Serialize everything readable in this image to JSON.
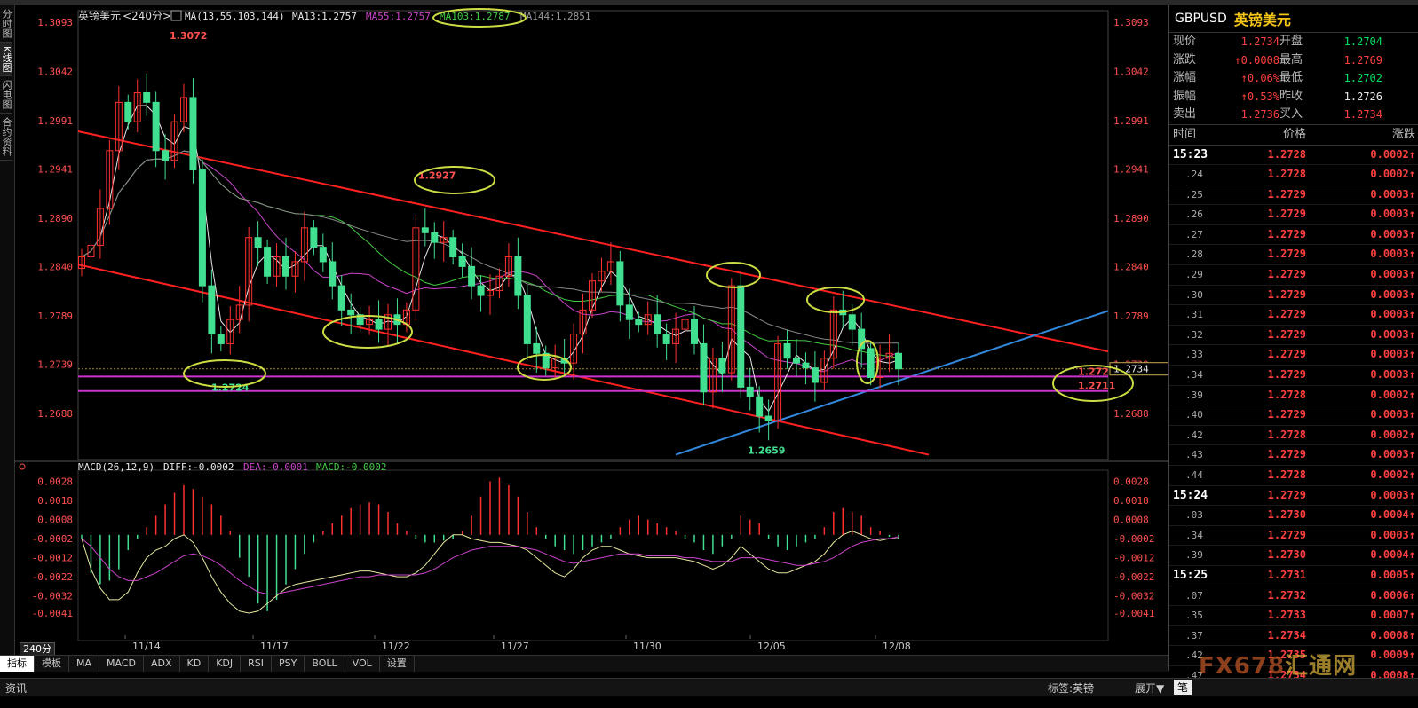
{
  "left_tabs": [
    "分时图",
    "K线图",
    "闪电图",
    "合约资料"
  ],
  "header": {
    "symbol": "英镑美元",
    "period": "<240分>",
    "ma_params": "MA(13,55,103,144)",
    "ma13": "MA13:1.2757",
    "ma55": "MA55:1.2757",
    "ma103": "MA103:1.2787",
    "ma144": "MA144:1.2851"
  },
  "macd_header": {
    "params": "MACD(26,12,9)",
    "diff": "DIFF:-0.0002",
    "dea": "DEA:-0.0001",
    "macd": "MACD:-0.0002"
  },
  "colors": {
    "up": "#ff3030",
    "down": "#40e090",
    "ma13": "#e8e8e8",
    "ma55": "#cc44cc",
    "ma103": "#44cc44",
    "ma144": "#888888",
    "channel": "#ff2020",
    "support": "#cc33cc",
    "trend_blue": "#3388dd",
    "highlight": "#ccdd44"
  },
  "chart_data": {
    "type": "candlestick",
    "symbol": "GBPUSD",
    "y_ticks": [
      "1.3093",
      "1.3042",
      "1.2991",
      "1.2941",
      "1.2890",
      "1.2840",
      "1.2789",
      "1.2739",
      "1.2688"
    ],
    "ylim": [
      1.264,
      1.3105
    ],
    "x_tick_labels": [
      "11/14",
      "11/17",
      "11/22",
      "11/27",
      "11/30",
      "12/05",
      "12/08"
    ],
    "annotations": [
      "1.3072",
      "1.2927",
      "1.2724",
      "1.2659",
      "1.2726",
      "1.2711"
    ],
    "current_price_tag": "1.2734",
    "support_levels": [
      1.2726,
      1.2711
    ],
    "closes": [
      1.285,
      1.2862,
      1.29,
      1.296,
      1.301,
      1.299,
      1.302,
      1.301,
      1.296,
      1.295,
      1.299,
      1.3015,
      1.294,
      1.282,
      1.277,
      1.276,
      1.2785,
      1.28,
      1.287,
      1.286,
      1.283,
      1.285,
      1.283,
      1.2845,
      1.288,
      1.286,
      1.2845,
      1.282,
      1.2795,
      1.279,
      1.278,
      1.2785,
      1.2775,
      1.279,
      1.278,
      1.2795,
      1.288,
      1.2875,
      1.2865,
      1.287,
      1.285,
      1.284,
      1.282,
      1.281,
      1.2815,
      1.283,
      1.285,
      1.281,
      1.276,
      1.275,
      1.2735,
      1.2745,
      1.274,
      1.277,
      1.2795,
      1.2825,
      1.2835,
      1.2845,
      1.28,
      1.2785,
      1.278,
      1.279,
      1.277,
      1.276,
      1.2775,
      1.2785,
      1.276,
      1.271,
      1.2745,
      1.273,
      1.282,
      1.2715,
      1.2705,
      1.2685,
      1.268,
      1.276,
      1.2745,
      1.274,
      1.2735,
      1.272,
      1.2745,
      1.2795,
      1.279,
      1.2775,
      1.2755,
      1.2725,
      1.2745,
      1.275,
      1.2734
    ],
    "macd_y_ticks": [
      "0.0028",
      "0.0018",
      "0.0008",
      "-0.0002",
      "-0.0012",
      "-0.0022",
      "-0.0032",
      "-0.0041"
    ],
    "macd_ylim": [
      -0.0048,
      0.0032
    ],
    "macd_hist": [
      -0.0002,
      -0.002,
      -0.0026,
      -0.0024,
      -0.0018,
      -0.0008,
      -0.0002,
      0.0004,
      0.001,
      0.0016,
      0.0022,
      0.0026,
      0.0024,
      0.002,
      0.0016,
      0.001,
      0.0002,
      -0.0012,
      -0.0022,
      -0.0036,
      -0.004,
      -0.0034,
      -0.0026,
      -0.0018,
      -0.001,
      -0.0004,
      0.0002,
      0.0006,
      0.001,
      0.0014,
      0.0016,
      0.0017,
      0.0016,
      0.0012,
      0.0006,
      0.0002,
      -0.0002,
      -0.0004,
      -0.0004,
      -0.0003,
      -0.0002,
      0.0002,
      0.001,
      0.002,
      0.0028,
      0.003,
      0.0026,
      0.002,
      0.0012,
      0.0004,
      -0.0002,
      -0.0006,
      -0.0008,
      -0.001,
      -0.0008,
      -0.0006,
      -0.0004,
      -0.0002,
      0.0004,
      0.0008,
      0.001,
      0.0008,
      0.0006,
      0.0004,
      0.0002,
      -0.0002,
      -0.0004,
      -0.0008,
      -0.001,
      -0.0006,
      -0.0002,
      0.001,
      0.0008,
      0.0006,
      -0.0002,
      -0.0006,
      -0.0008,
      -0.0006,
      -0.0004,
      -0.0002,
      0.0004,
      0.0012,
      0.0014,
      0.0012,
      0.001,
      0.0004,
      0.0002,
      -0.0001,
      -0.0002
    ],
    "macd_diff": [
      -0.0002,
      -0.0018,
      -0.0028,
      -0.0034,
      -0.0034,
      -0.003,
      -0.002,
      -0.0012,
      -0.0008,
      -0.0006,
      -0.0002,
      0.0,
      -0.0004,
      -0.0012,
      -0.0022,
      -0.003,
      -0.0036,
      -0.004,
      -0.0041,
      -0.004,
      -0.0036,
      -0.0032,
      -0.0028,
      -0.0026,
      -0.0025,
      -0.0024,
      -0.0023,
      -0.0022,
      -0.0021,
      -0.002,
      -0.0019,
      -0.0019,
      -0.002,
      -0.0021,
      -0.0022,
      -0.0022,
      -0.002,
      -0.0016,
      -0.001,
      -0.0004,
      0.0,
      0.0,
      -0.0002,
      -0.0003,
      -0.0004,
      -0.0004,
      -0.0005,
      -0.0006,
      -0.0008,
      -0.0012,
      -0.0016,
      -0.002,
      -0.0022,
      -0.0018,
      -0.0012,
      -0.0008,
      -0.0006,
      -0.0006,
      -0.0008,
      -0.001,
      -0.0011,
      -0.0012,
      -0.0012,
      -0.0012,
      -0.0012,
      -0.0013,
      -0.0014,
      -0.0016,
      -0.0018,
      -0.0016,
      -0.0012,
      -0.0006,
      -0.001,
      -0.0014,
      -0.0018,
      -0.002,
      -0.002,
      -0.0018,
      -0.0016,
      -0.0014,
      -0.001,
      -0.0004,
      0.0,
      0.0002,
      0.0,
      -0.0002,
      -0.0003,
      -0.0002,
      -0.0002
    ],
    "macd_dea": [
      -0.0002,
      -0.0006,
      -0.0012,
      -0.0018,
      -0.0022,
      -0.0024,
      -0.0024,
      -0.0022,
      -0.002,
      -0.0017,
      -0.0014,
      -0.0011,
      -0.001,
      -0.0011,
      -0.0013,
      -0.0016,
      -0.002,
      -0.0024,
      -0.0027,
      -0.003,
      -0.0031,
      -0.0031,
      -0.003,
      -0.0029,
      -0.0028,
      -0.0027,
      -0.0026,
      -0.0025,
      -0.0024,
      -0.0023,
      -0.0022,
      -0.0022,
      -0.0021,
      -0.0021,
      -0.0021,
      -0.0021,
      -0.0021,
      -0.002,
      -0.0018,
      -0.0015,
      -0.0012,
      -0.001,
      -0.0008,
      -0.0007,
      -0.0006,
      -0.0006,
      -0.0006,
      -0.0006,
      -0.0007,
      -0.0008,
      -0.001,
      -0.0012,
      -0.0014,
      -0.0015,
      -0.0014,
      -0.0013,
      -0.0012,
      -0.0011,
      -0.001,
      -0.001,
      -0.001,
      -0.0011,
      -0.0011,
      -0.0011,
      -0.0011,
      -0.0012,
      -0.0012,
      -0.0013,
      -0.0014,
      -0.0014,
      -0.0014,
      -0.0012,
      -0.0012,
      -0.0012,
      -0.0013,
      -0.0014,
      -0.0015,
      -0.0016,
      -0.0016,
      -0.0015,
      -0.0014,
      -0.0012,
      -0.0009,
      -0.0006,
      -0.0004,
      -0.0003,
      -0.0002,
      -0.0002,
      -0.0001
    ]
  },
  "bottom_tabs": [
    "指标",
    "模板",
    "MA",
    "MACD",
    "ADX",
    "KD",
    "KDJ",
    "RSI",
    "PSY",
    "BOLL",
    "VOL",
    "设置"
  ],
  "period_label": "240分",
  "quote_panel": {
    "code": "GBPUSD",
    "name": "英镑美元",
    "rows": [
      {
        "k1": "现价",
        "v1": "1.2734",
        "c1": "red",
        "k2": "开盘",
        "v2": "1.2704",
        "c2": "green"
      },
      {
        "k1": "涨跌",
        "v1": "↑0.0008",
        "c1": "red",
        "k2": "最高",
        "v2": "1.2769",
        "c2": "red"
      },
      {
        "k1": "涨幅",
        "v1": "↑0.06%",
        "c1": "red",
        "k2": "最低",
        "v2": "1.2702",
        "c2": "green"
      },
      {
        "k1": "振幅",
        "v1": "↑0.53%",
        "c1": "red",
        "k2": "昨收",
        "v2": "1.2726",
        "c2": "white"
      },
      {
        "k1": "卖出",
        "v1": "1.2736",
        "c1": "red",
        "k2": "买入",
        "v2": "1.2734",
        "c2": "red"
      }
    ],
    "tick_header": [
      "时间",
      "价格",
      "涨跌"
    ],
    "ticks": [
      {
        "t": "15:23",
        "p": "1.2728",
        "c": "0.0002↑",
        "big": true
      },
      {
        "t": ".24",
        "p": "1.2728",
        "c": "0.0002↑"
      },
      {
        "t": ".25",
        "p": "1.2729",
        "c": "0.0003↑"
      },
      {
        "t": ".26",
        "p": "1.2729",
        "c": "0.0003↑"
      },
      {
        "t": ".27",
        "p": "1.2729",
        "c": "0.0003↑"
      },
      {
        "t": ".28",
        "p": "1.2729",
        "c": "0.0003↑"
      },
      {
        "t": ".29",
        "p": "1.2729",
        "c": "0.0003↑"
      },
      {
        "t": ".30",
        "p": "1.2729",
        "c": "0.0003↑"
      },
      {
        "t": ".31",
        "p": "1.2729",
        "c": "0.0003↑"
      },
      {
        "t": ".32",
        "p": "1.2729",
        "c": "0.0003↑"
      },
      {
        "t": ".33",
        "p": "1.2729",
        "c": "0.0003↑"
      },
      {
        "t": ".34",
        "p": "1.2729",
        "c": "0.0003↑"
      },
      {
        "t": ".39",
        "p": "1.2728",
        "c": "0.0002↑"
      },
      {
        "t": ".40",
        "p": "1.2729",
        "c": "0.0003↑"
      },
      {
        "t": ".42",
        "p": "1.2728",
        "c": "0.0002↑"
      },
      {
        "t": ".43",
        "p": "1.2729",
        "c": "0.0003↑"
      },
      {
        "t": ".44",
        "p": "1.2728",
        "c": "0.0002↑"
      },
      {
        "t": "15:24",
        "p": "1.2729",
        "c": "0.0003↑",
        "big": true
      },
      {
        "t": ".03",
        "p": "1.2730",
        "c": "0.0004↑"
      },
      {
        "t": ".34",
        "p": "1.2729",
        "c": "0.0003↑"
      },
      {
        "t": ".39",
        "p": "1.2730",
        "c": "0.0004↑"
      },
      {
        "t": "15:25",
        "p": "1.2731",
        "c": "0.0005↑",
        "big": true
      },
      {
        "t": ".07",
        "p": "1.2732",
        "c": "0.0006↑"
      },
      {
        "t": ".35",
        "p": "1.2733",
        "c": "0.0007↑"
      },
      {
        "t": ".37",
        "p": "1.2734",
        "c": "0.0008↑"
      },
      {
        "t": ".42",
        "p": "1.2735",
        "c": "0.0009↑"
      },
      {
        "t": ".47",
        "p": "1.2734",
        "c": "0.0008↑"
      }
    ]
  },
  "status": {
    "left": "资讯",
    "tag": "标签:英镑",
    "expand": "展开▼",
    "pen": "笔"
  },
  "watermark": {
    "brand": "FX678",
    "cn": "汇通网"
  }
}
